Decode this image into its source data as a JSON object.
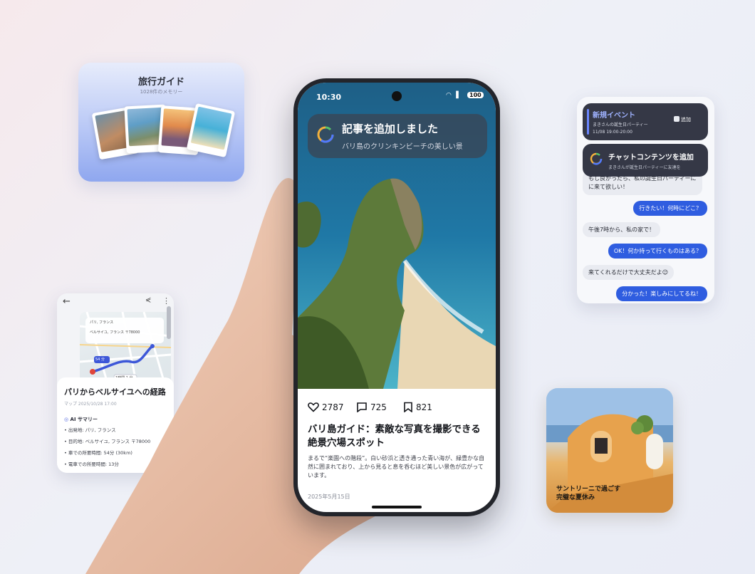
{
  "guide_card": {
    "title": "旅行ガイド",
    "subtitle": "1028件のメモリー"
  },
  "map_card": {
    "search_from": "パリ, フランス",
    "search_to": "ベルサイユ, フランス 〒78000",
    "route_time_1": "54 分",
    "route_time_2": "1時間 1 分",
    "title": "パリからベルサイユへの経路",
    "meta": "マップ 2025/10/28 17:00",
    "ai_heading": "AI サマリー",
    "bullets": [
      "• 出発地: パリ, フランス",
      "• 目的地: ベルサイユ, フランス 〒78000",
      "• 車での所要時間: 54分 (30km)",
      "• 電車での所要時間: 13分"
    ]
  },
  "chat_card": {
    "event_title": "新規イベント",
    "event_desc": "まきさんの誕生日パーティー",
    "event_time": "11/08 19:00-20:00",
    "add_label": "追加",
    "chat_notif_title": "チャットコンテンツを追加",
    "chat_notif_sub": "まきさんが誕生日パーティーに友達を",
    "messages": [
      {
        "dir": "in",
        "text": "もし良かったら、私の誕生日パーティーにに来て欲しい！"
      },
      {
        "dir": "out",
        "text": "行きたい！何時にどこ？"
      },
      {
        "dir": "in",
        "text": "午後7時から、私の家で！"
      },
      {
        "dir": "out",
        "text": "OK！何か持って行くものはある？"
      },
      {
        "dir": "in",
        "text": "来てくれるだけで大丈夫だよ😉"
      },
      {
        "dir": "out",
        "text": "分かった！楽しみにしてるね！"
      }
    ]
  },
  "santorini_card": {
    "line1": "サントリーニで過ごす",
    "line2": "完璧な夏休み"
  },
  "phone": {
    "status": {
      "time": "10:30",
      "battery": "100"
    },
    "notification": {
      "title": "記事を追加しました",
      "subtitle": "バリ島のクリンキンビーチの美しい景"
    },
    "likes": "2787",
    "comments": "725",
    "saves": "821",
    "post_title": "バリ島ガイド：素敵な写真を撮影できる絶景穴場スポット",
    "post_body": "まるで“楽園への階段”。白い砂浜と透き通った青い海が、緑豊かな自然に囲まれており、上から見ると息を呑むほど美しい景色が広がっています。",
    "post_date": "2025年5月15日"
  }
}
